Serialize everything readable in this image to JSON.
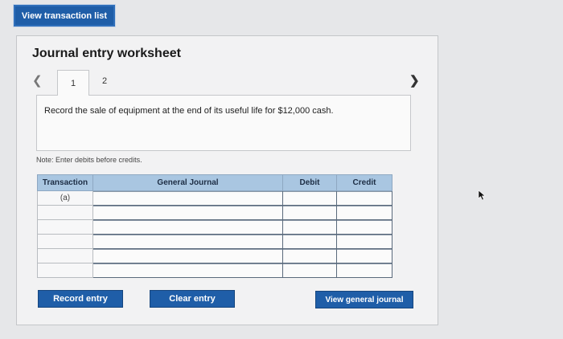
{
  "header": {
    "view_list_button": "View transaction list"
  },
  "worksheet": {
    "title": "Journal entry worksheet",
    "prev_icon": "chevron-left-icon",
    "next_icon": "chevron-right-icon",
    "tabs": [
      {
        "label": "1",
        "selected": true
      },
      {
        "label": "2",
        "selected": false
      }
    ],
    "instruction": "Record the sale of equipment at the end of its useful life for $12,000 cash.",
    "note": "Note: Enter debits before credits."
  },
  "table": {
    "headers": {
      "transaction": "Transaction",
      "journal": "General Journal",
      "debit": "Debit",
      "credit": "Credit"
    },
    "rows": [
      {
        "transaction": "(a)",
        "account": "",
        "debit": "",
        "credit": ""
      },
      {
        "transaction": "",
        "account": "",
        "debit": "",
        "credit": ""
      },
      {
        "transaction": "",
        "account": "",
        "debit": "",
        "credit": ""
      },
      {
        "transaction": "",
        "account": "",
        "debit": "",
        "credit": ""
      },
      {
        "transaction": "",
        "account": "",
        "debit": "",
        "credit": ""
      },
      {
        "transaction": "",
        "account": "",
        "debit": "",
        "credit": ""
      }
    ]
  },
  "buttons": {
    "record": "Record entry",
    "clear": "Clear entry",
    "view_general": "View general journal"
  },
  "colors": {
    "button_blue": "#1f5ea8",
    "header_blue": "#a9c6e1",
    "background": "#e6e7e9"
  }
}
